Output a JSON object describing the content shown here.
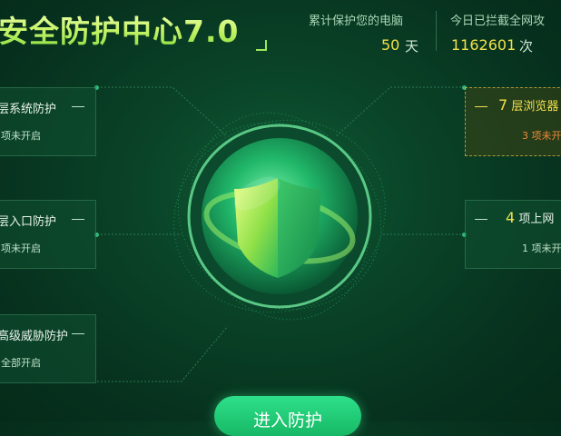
{
  "header": {
    "title": "安全防护中心7.0",
    "days_label": "累计保护您的电脑",
    "days_value": "50",
    "days_unit": "天",
    "blocked_label": "今日已拦截全网攻",
    "blocked_value": "1162601",
    "blocked_unit": "次"
  },
  "left_panels": [
    {
      "title": "层系统防护",
      "status": "项未开启"
    },
    {
      "title": "层入口防护",
      "status": "项未开启"
    },
    {
      "title": "高级威胁防护",
      "status": "全部开启"
    }
  ],
  "right_panels": [
    {
      "count": "7",
      "title": "层浏览器",
      "status_count": "3",
      "status": "项未开"
    },
    {
      "count": "4",
      "title": "项上网",
      "status_count": "1",
      "status": "项未开"
    }
  ],
  "enter_button": {
    "label": "进入防护"
  },
  "colors": {
    "accent": "#2ee08a",
    "highlight": "#f2e04a",
    "warning": "#f08a3a"
  },
  "icons": {
    "center": "shield-icon"
  }
}
